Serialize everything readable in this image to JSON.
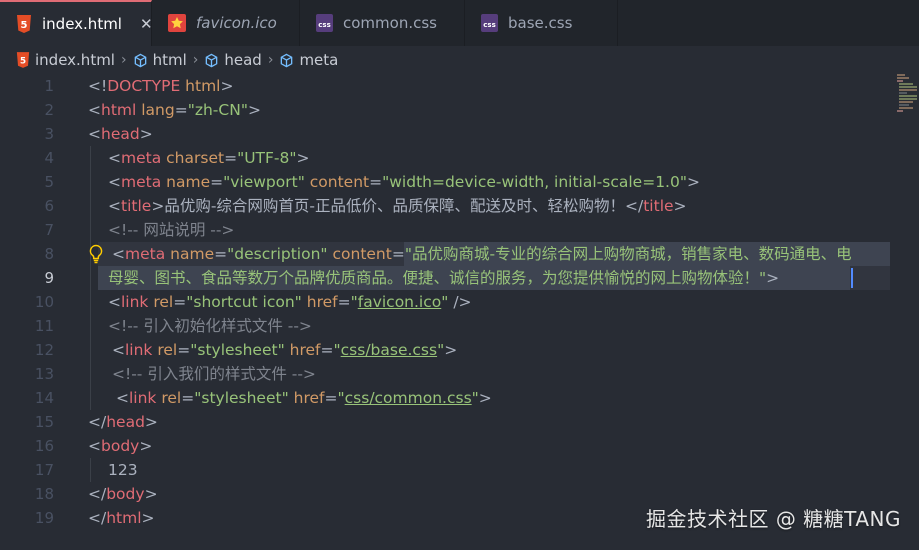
{
  "tabs": [
    {
      "label": "index.html",
      "icon": "html5-icon",
      "active": true,
      "close": "✕"
    },
    {
      "label": "favicon.ico",
      "icon": "star-icon",
      "active": false
    },
    {
      "label": "common.css",
      "icon": "css-file-icon",
      "active": false
    },
    {
      "label": "base.css",
      "icon": "css-file-icon",
      "active": false
    }
  ],
  "icon_labels": {
    "html5": "5",
    "css": "css"
  },
  "breadcrumb": [
    "index.html",
    "html",
    "head",
    "meta"
  ],
  "breadcrumb_sep": "›",
  "line_numbers": [
    "1",
    "2",
    "3",
    "4",
    "5",
    "6",
    "7",
    "8",
    "9",
    "10",
    "11",
    "12",
    "13",
    "14",
    "15",
    "16",
    "17",
    "18",
    "19"
  ],
  "current_line": "9",
  "code": {
    "l1": {
      "open": "<!",
      "tag": "DOCTYPE",
      "rest": " html",
      "close": ">"
    },
    "l2": {
      "open": "<",
      "tag": "html",
      "attr": " lang",
      "eq": "=",
      "val": "\"zh-CN\"",
      "close": ">"
    },
    "l3": {
      "open": "<",
      "tag": "head",
      "close": ">"
    },
    "l4": {
      "open": "<",
      "tag": "meta",
      "attr": " charset",
      "eq": "=",
      "val": "\"UTF-8\"",
      "close": ">"
    },
    "l5": {
      "open": "<",
      "tag": "meta",
      "attr1": " name",
      "eq1": "=",
      "val1": "\"viewport\"",
      "attr2": " content",
      "eq2": "=",
      "val2": "\"width=device-width, initial-scale=1.0\"",
      "close": ">"
    },
    "l6": {
      "open": "<",
      "tag": "title",
      "gt": ">",
      "text": "品优购-综合网购首页-正品低价、品质保障、配送及时、轻松购物！",
      "endopen": "</",
      "endtag": "title",
      "close": ">"
    },
    "l7": {
      "comment": "<!-- 网站说明 -->"
    },
    "l8": {
      "open": "<",
      "tag": "meta",
      "attr1": " name",
      "eq1": "=",
      "val1": "\"description\"",
      "attr2": " content",
      "eq2": "=",
      "val2": "\"品优购商城-专业的综合网上购物商城，销售家电、数码通电、电"
    },
    "l9": {
      "text": "母婴、图书、食品等数万个品牌优质商品。便捷、诚信的服务，为您提供愉悦的网上购物体验！",
      "quote": "\"",
      "close": ">"
    },
    "l10": {
      "open": "<",
      "tag": "link",
      "attr1": " rel",
      "eq1": "=",
      "val1": "\"shortcut icon\"",
      "attr2": " href",
      "eq2": "=",
      "q1": "\"",
      "link": "favicon.ico",
      "q2": "\"",
      "close": " />"
    },
    "l11": {
      "comment": "<!-- 引入初始化样式文件 -->"
    },
    "l12": {
      "open": "<",
      "tag": "link",
      "attr1": " rel",
      "eq1": "=",
      "val1": "\"stylesheet\"",
      "attr2": " href",
      "eq2": "=",
      "q1": "\"",
      "link": "css/base.css",
      "q2": "\"",
      "close": ">"
    },
    "l13": {
      "comment": "<!-- 引入我们的样式文件 -->"
    },
    "l14": {
      "open": "<",
      "tag": "link",
      "attr1": " rel",
      "eq1": "=",
      "val1": "\"stylesheet\"",
      "attr2": " href",
      "eq2": "=",
      "q1": "\"",
      "link": "css/common.css",
      "q2": "\"",
      "close": ">"
    },
    "l15": {
      "open": "</",
      "tag": "head",
      "close": ">"
    },
    "l16": {
      "open": "<",
      "tag": "body",
      "close": ">"
    },
    "l17": {
      "text": "123"
    },
    "l18": {
      "open": "</",
      "tag": "body",
      "close": ">"
    },
    "l19": {
      "open": "</",
      "tag": "html",
      "close": ">"
    }
  },
  "watermark": "掘金技术社区 @ 糖糖TANG",
  "colors": {
    "background": "#282c34",
    "tag": "#e06c75",
    "attribute": "#d19a66",
    "string": "#98c379",
    "comment": "#7f848e",
    "selection": "#3e4451"
  }
}
